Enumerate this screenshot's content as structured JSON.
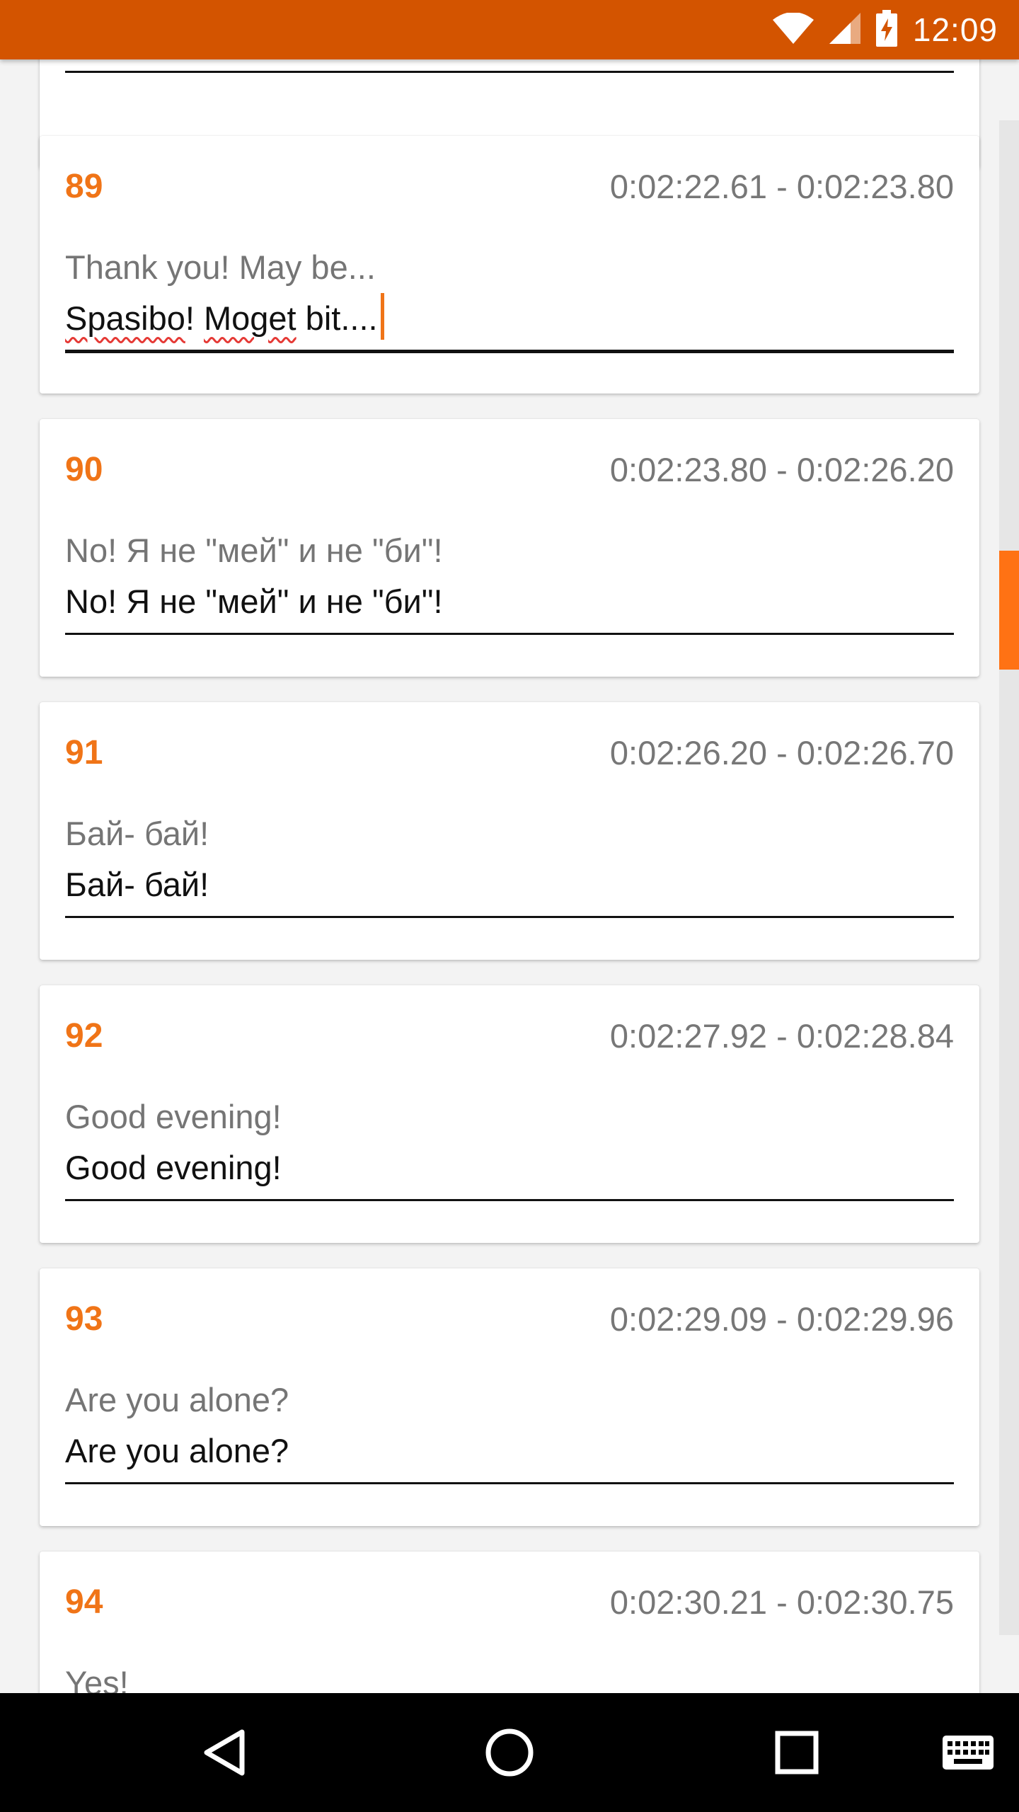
{
  "status_bar": {
    "time": "12:09",
    "icons": [
      "wifi-icon",
      "cell-signal-icon",
      "battery-charging-icon"
    ]
  },
  "subtitles": [
    {
      "index": "89",
      "time_range": "0:02:22.61 - 0:02:23.80",
      "original": "Thank you! May be...",
      "edited": "Spasibo! Moget bit....",
      "focused": true
    },
    {
      "index": "90",
      "time_range": "0:02:23.80 - 0:02:26.20",
      "original": "No! Я не \"мей\" и не \"би\"!",
      "edited": "No! Я не \"мей\" и не \"би\"!"
    },
    {
      "index": "91",
      "time_range": "0:02:26.20 - 0:02:26.70",
      "original": "Бай- бай!",
      "edited": "Бай- бай!"
    },
    {
      "index": "92",
      "time_range": "0:02:27.92 - 0:02:28.84",
      "original": "Good evening!",
      "edited": "Good evening!"
    },
    {
      "index": "93",
      "time_range": "0:02:29.09 - 0:02:29.96",
      "original": "Are you alone?",
      "edited": "Are you alone?"
    },
    {
      "index": "94",
      "time_range": "0:02:30.21 - 0:02:30.75",
      "original": "Yes!",
      "edited": ""
    }
  ],
  "spellcheck": {
    "word1": "Spasibo",
    "punct1": "! ",
    "word2": "Moget",
    "rest": " bit...."
  },
  "nav_bar": {
    "icons": [
      "back-icon",
      "home-icon",
      "recents-icon",
      "keyboard-icon"
    ]
  },
  "colors": {
    "status_bar": "#d35400",
    "accent": "#f07417",
    "card_bg": "#ffffff",
    "page_bg": "#f3f3f3"
  }
}
